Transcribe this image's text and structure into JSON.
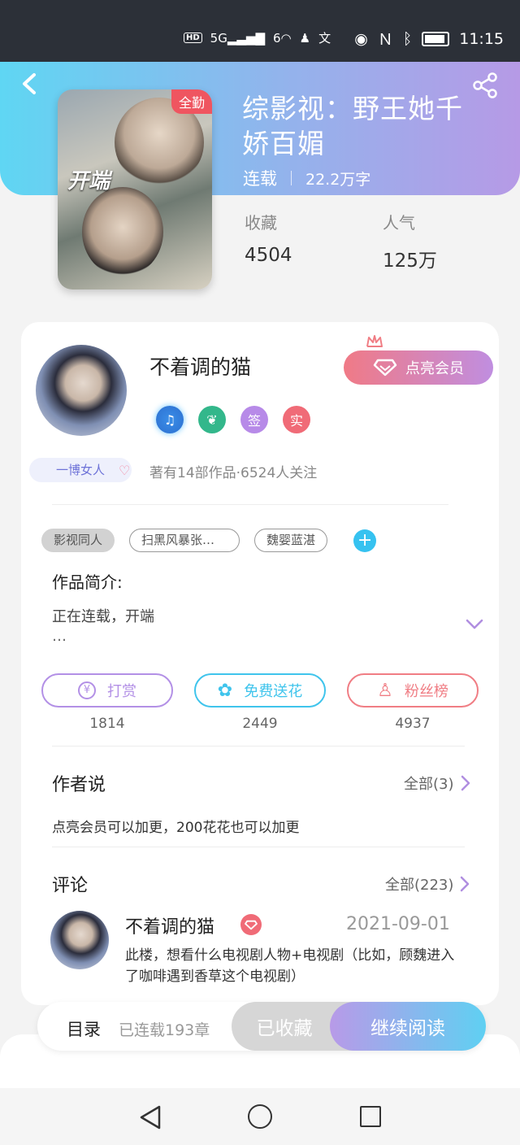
{
  "status_bar": {
    "time": "11:15",
    "signal": "5G",
    "wifi": "6",
    "hd": "HD",
    "icons": [
      "hd-icon",
      "signal-icon",
      "wifi-icon",
      "qq-icon",
      "translate-icon",
      "eye-icon",
      "nfc-icon",
      "bluetooth-icon",
      "battery-icon"
    ]
  },
  "book": {
    "cover_badge": "全勤",
    "cover_logo": "开端",
    "title": "综影视：野王她千娇百媚",
    "status": "连载",
    "word_count": "22.2万字",
    "stats": [
      {
        "label": "收藏",
        "value": "4504"
      },
      {
        "label": "人气",
        "value": "125万"
      }
    ]
  },
  "author": {
    "name": "不着调的猫",
    "tag": "一博女人",
    "member_button": "点亮会员",
    "badges": [
      "music-badge-icon",
      "leaf-badge-icon",
      "签",
      "实"
    ],
    "stats_text": "著有14部作品·6524人关注"
  },
  "tags": [
    "影视同人",
    "扫黑风暴张…",
    "魏婴蓝湛"
  ],
  "intro": {
    "label": "作品简介:",
    "text": "正在连载，开端",
    "ellipsis": "…"
  },
  "actions": [
    {
      "label": "打赏",
      "count": "1814",
      "color": "#b390e6",
      "icon": "yen-icon"
    },
    {
      "label": "免费送花",
      "count": "2449",
      "color": "#3fc4ec",
      "icon": "flower-icon"
    },
    {
      "label": "粉丝榜",
      "count": "4937",
      "color": "#f07d84",
      "icon": "fan-icon"
    }
  ],
  "author_say": {
    "title": "作者说",
    "more": "全部(3)",
    "text": "点亮会员可以加更，200花花也可以加更"
  },
  "comments": {
    "title": "评论",
    "more": "全部(223)",
    "items": [
      {
        "user": "不着调的猫",
        "date": "2021-09-01",
        "text": "此楼，想看什么电视剧人物+电视剧（比如，顾魏进入了咖啡遇到香草这个电视剧）"
      }
    ]
  },
  "bottom": {
    "toc": "目录",
    "chapters": "已连载193章",
    "favorited": "已收藏",
    "continue": "继续阅读"
  },
  "colors": {
    "accent_cyan": "#5fd6f3",
    "accent_purple": "#b69ae6",
    "brand_pink": "#f06b77"
  }
}
